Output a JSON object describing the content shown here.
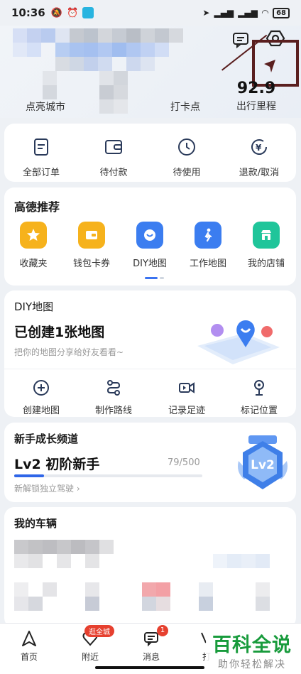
{
  "status_bar": {
    "time": "10:36",
    "battery": "68"
  },
  "header": {
    "stats": [
      {
        "label": "点亮城市"
      },
      {
        "label": "打卡点"
      },
      {
        "value": "92.9",
        "label": "出行里程"
      }
    ],
    "icons": [
      "message-icon",
      "settings-icon"
    ]
  },
  "orders": {
    "items": [
      {
        "label": "全部订单",
        "icon": "order-list-icon"
      },
      {
        "label": "待付款",
        "icon": "wallet-icon"
      },
      {
        "label": "待使用",
        "icon": "clock-icon"
      },
      {
        "label": "退款/取消",
        "icon": "refund-icon"
      }
    ]
  },
  "recommend": {
    "title": "高德推荐",
    "items": [
      {
        "label": "收藏夹",
        "icon": "star-icon",
        "color": "#f5a623"
      },
      {
        "label": "钱包卡券",
        "icon": "wallet-card-icon",
        "color": "#f5a623"
      },
      {
        "label": "DIY地图",
        "icon": "diy-map-icon",
        "color": "#3b7df0"
      },
      {
        "label": "工作地图",
        "icon": "walk-icon",
        "color": "#3b7df0"
      },
      {
        "label": "我的店铺",
        "icon": "shop-icon",
        "color": "#1fc59a"
      }
    ]
  },
  "diy": {
    "title": "DIY地图",
    "headline": "已创建1张地图",
    "subtitle": "把你的地图分享给好友看看~",
    "actions": [
      {
        "label": "创建地图",
        "icon": "plus-circle-icon"
      },
      {
        "label": "制作路线",
        "icon": "route-icon"
      },
      {
        "label": "记录足迹",
        "icon": "video-icon"
      },
      {
        "label": "标记位置",
        "icon": "pin-icon"
      }
    ]
  },
  "growth": {
    "title": "新手成长频道",
    "level": "Lv2 初阶新手",
    "progress_text": "79/500",
    "progress_fraction": 0.158,
    "unlock": "新解锁独立驾驶",
    "badge": "Lv2"
  },
  "vehicles": {
    "title": "我的车辆"
  },
  "tabbar": {
    "tabs": [
      {
        "label": "首页",
        "icon": "navigate-icon"
      },
      {
        "label": "附近",
        "icon": "heart-icon",
        "badge": "逛全城"
      },
      {
        "label": "消息",
        "icon": "chat-icon",
        "badge": "1"
      },
      {
        "label": "打",
        "icon": "tab-icon"
      }
    ]
  },
  "watermark": {
    "title": "百科全说",
    "subtitle": "助你轻松解决"
  },
  "colors": {
    "accent": "#2f66e8",
    "annotation": "#5a1f1f",
    "badge": "#e6402f"
  }
}
